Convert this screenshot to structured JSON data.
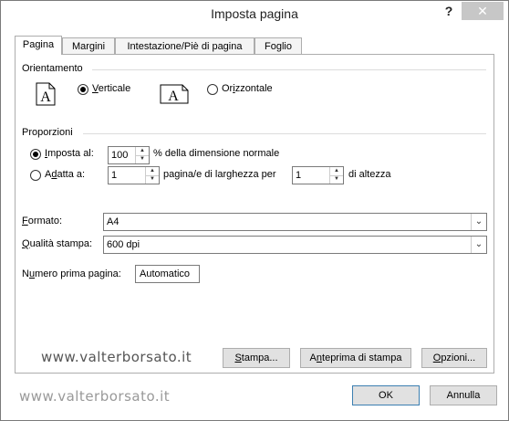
{
  "window": {
    "title": "Imposta pagina",
    "help": "?",
    "close": "✕"
  },
  "tabs": [
    {
      "label": "Pagina",
      "active": true
    },
    {
      "label": "Margini",
      "active": false
    },
    {
      "label": "Intestazione/Piè di pagina",
      "active": false
    },
    {
      "label": "Foglio",
      "active": false
    }
  ],
  "orientation": {
    "heading": "Orientamento",
    "portrait": {
      "label_u": "V",
      "label_rest": "erticale",
      "selected": true,
      "icon_letter": "A"
    },
    "landscape": {
      "label_pre": "Or",
      "label_u": "i",
      "label_rest": "zzontale",
      "selected": false,
      "icon_letter": "A"
    }
  },
  "scaling": {
    "heading": "Proporzioni",
    "adjust": {
      "label_u": "I",
      "label_rest": "mposta al:",
      "selected": true,
      "value": "100",
      "suffix": "% della dimensione normale"
    },
    "fit": {
      "label_pre": "A",
      "label_u": "d",
      "label_rest": "atta a:",
      "selected": false,
      "wide_value": "1",
      "wide_suffix": "pagina/e di larghezza per",
      "tall_value": "1",
      "tall_suffix": "di altezza"
    }
  },
  "paper": {
    "label_u": "F",
    "label_rest": "ormato:",
    "value": "A4"
  },
  "quality": {
    "label_u": "Q",
    "label_rest": "ualità stampa:",
    "value": "600 dpi"
  },
  "first_page": {
    "label_pre": "N",
    "label_u": "u",
    "label_rest": "mero prima pagina:",
    "value": "Automatico"
  },
  "watermark": "www.valterborsato.it",
  "buttons": {
    "print": {
      "u": "S",
      "rest": "tampa..."
    },
    "preview": {
      "pre": "A",
      "u": "n",
      "rest": "teprima di stampa"
    },
    "options": {
      "u": "O",
      "rest": "pzioni..."
    },
    "ok": "OK",
    "cancel": "Annulla"
  }
}
